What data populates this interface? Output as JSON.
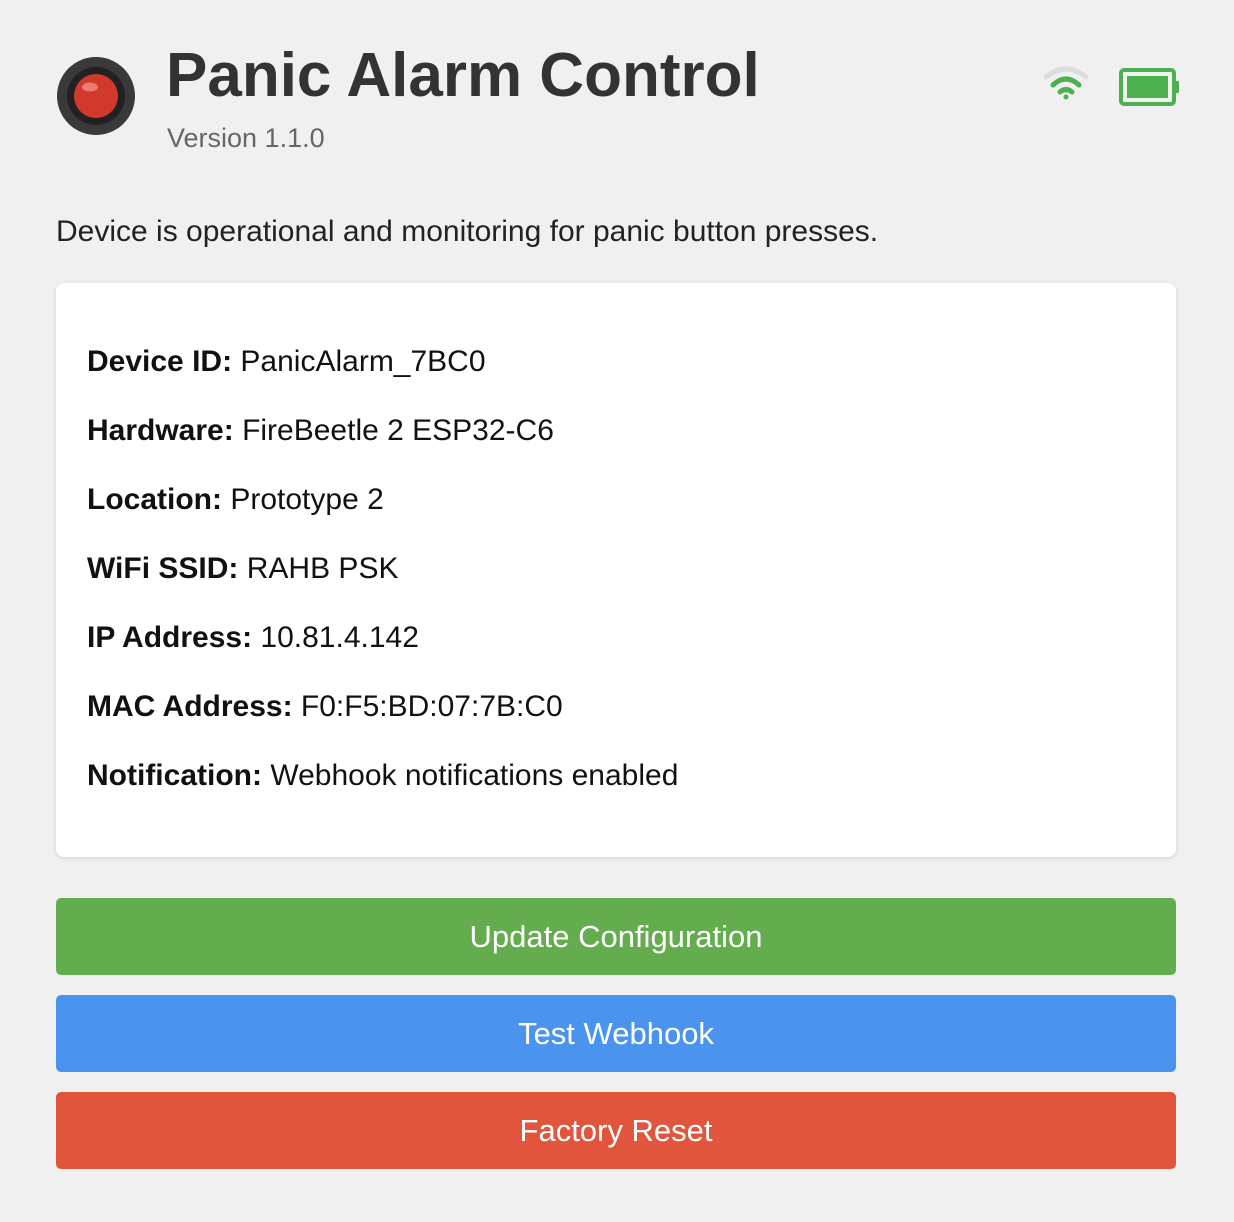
{
  "header": {
    "title": "Panic Alarm Control",
    "version": "Version 1.1.0",
    "status_icons": {
      "wifi": "wifi-icon",
      "battery": "battery-icon"
    }
  },
  "status_message": "Device is operational and monitoring for panic button presses.",
  "device_info": [
    {
      "label": "Device ID:",
      "value": "PanicAlarm_7BC0"
    },
    {
      "label": "Hardware:",
      "value": "FireBeetle 2 ESP32-C6"
    },
    {
      "label": "Location:",
      "value": "Prototype 2"
    },
    {
      "label": "WiFi SSID:",
      "value": "RAHB PSK"
    },
    {
      "label": "IP Address:",
      "value": "10.81.4.142"
    },
    {
      "label": "MAC Address:",
      "value": "F0:F5:BD:07:7B:C0"
    },
    {
      "label": "Notification:",
      "value": "Webhook notifications enabled"
    }
  ],
  "actions": {
    "update_label": "Update Configuration",
    "test_label": "Test Webhook",
    "reset_label": "Factory Reset"
  },
  "colors": {
    "update": "#63ad4f",
    "test": "#4a94ef",
    "reset": "#e2553d",
    "wifi": "#4caf50",
    "battery": "#4caf50",
    "alarm_button": "#d0392b"
  }
}
